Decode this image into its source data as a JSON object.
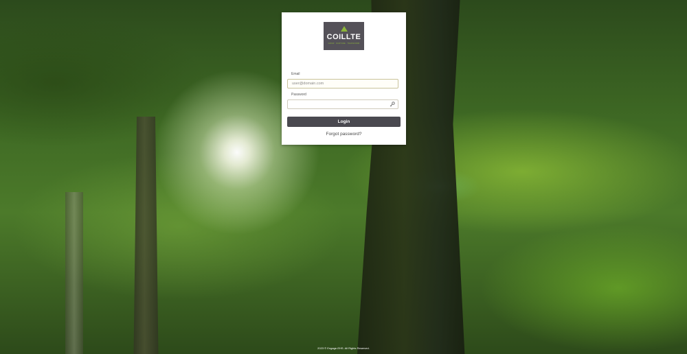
{
  "brand": {
    "name": "COILLTE",
    "tagline": "GROW · NURTURE · TRANSFORM",
    "accent_color": "#8db53a",
    "logo_bg": "#545158"
  },
  "form": {
    "email_label": "Email",
    "email_placeholder": "user@domain.com",
    "password_label": "Password",
    "password_icon": "key-icon",
    "login_label": "Login",
    "forgot_label": "Forgot password?"
  },
  "footer": {
    "text": "2023 © Engage-EHS. All Rights Reserved."
  }
}
